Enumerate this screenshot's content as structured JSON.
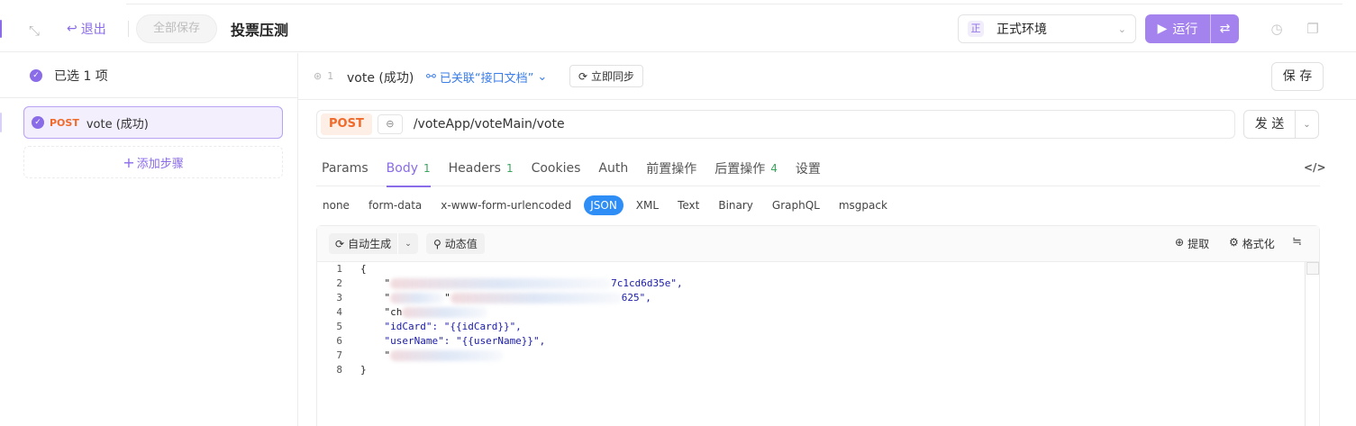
{
  "topbar": {
    "exit_label": "退出",
    "save_all_label": "全部保存",
    "title": "投票压测",
    "env_badge": "正",
    "env_label": "正式环境",
    "run_label": "运行"
  },
  "sidebar": {
    "selected_label": "已选 1 项",
    "steps": [
      {
        "method": "POST",
        "name": "vote (成功)"
      }
    ],
    "add_step_label": "添加步骤"
  },
  "request": {
    "step_number": "1",
    "name": "vote (成功)",
    "linked_label": "已关联“接口文档”",
    "sync_label": "立即同步",
    "save_label": "保 存",
    "method": "POST",
    "url": "/voteApp/voteMain/vote",
    "send_label": "发 送"
  },
  "tabs": [
    {
      "label": "Params",
      "count": ""
    },
    {
      "label": "Body",
      "count": "1"
    },
    {
      "label": "Headers",
      "count": "1"
    },
    {
      "label": "Cookies",
      "count": ""
    },
    {
      "label": "Auth",
      "count": ""
    },
    {
      "label": "前置操作",
      "count": ""
    },
    {
      "label": "后置操作",
      "count": "4"
    },
    {
      "label": "设置",
      "count": ""
    }
  ],
  "active_tab": "Body",
  "body_types": [
    "none",
    "form-data",
    "x-www-form-urlencoded",
    "JSON",
    "XML",
    "Text",
    "Binary",
    "GraphQL",
    "msgpack"
  ],
  "active_body_type": "JSON",
  "editor": {
    "auto_gen_label": "自动生成",
    "dynamic_label": "动态值",
    "extract_label": "提取",
    "format_label": "格式化",
    "line_numbers": [
      "1",
      "2",
      "3",
      "4",
      "5",
      "6",
      "7",
      "8"
    ],
    "lines": {
      "l1": "{",
      "l2_a": "    \"",
      "l2_b": "7c1cd6d35e\",",
      "l3_a": "    \"",
      "l3_b": "\"",
      "l3_c": "625\",",
      "l4_a": "    \"ch",
      "l5": "    \"idCard\": \"{{idCard}}\",",
      "l6": "    \"userName\": \"{{userName}}\",",
      "l7_a": "    \"",
      "l8": "}"
    }
  },
  "colors": {
    "accent": "#8a6be8",
    "run_button": "#a583ef",
    "method_post": "#f06a2b",
    "link_blue": "#3a7de8",
    "json_active": "#2f8ef5",
    "count_green": "#3aa55c"
  }
}
